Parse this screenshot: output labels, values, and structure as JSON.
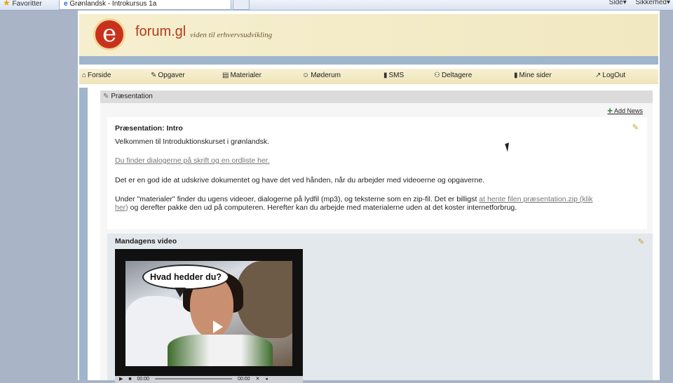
{
  "browser": {
    "favorites_label": "Favoritter",
    "tab_title": "Grønlandsk - Introkursus 1a",
    "tools": [
      "Side",
      "Sikkerhed"
    ]
  },
  "header": {
    "logo_letter": "e",
    "brand": "forum.gl",
    "slogan": "viden til erhvervsudvikling"
  },
  "nav": {
    "items": [
      {
        "label": "Forside",
        "icon": "home-icon"
      },
      {
        "label": "Opgaver",
        "icon": "tasks-icon"
      },
      {
        "label": "Materialer",
        "icon": "materials-icon"
      },
      {
        "label": "Møderum",
        "icon": "meeting-icon"
      },
      {
        "label": "SMS",
        "icon": "phone-icon"
      },
      {
        "label": "Deltagere",
        "icon": "people-icon"
      },
      {
        "label": "Mine sider",
        "icon": "user-icon"
      },
      {
        "label": "LogOut",
        "icon": "logout-icon"
      }
    ]
  },
  "panel": {
    "title": "Præsentation",
    "add_news": "Add News"
  },
  "content": {
    "title": "Præsentation: Intro",
    "welcome": "Velkommen til Introduktionskurset i grønlandsk.",
    "dialog_link": "Du finder dialogerne på skrift og en ordliste her.",
    "print_tip": "Det er en god ide at udskrive dokumentet og have det ved hånden, når du arbejder med videoerne og opgaverne.",
    "materials_text_1": "Under \"materialer\" finder du ugens videoer, dialogerne på lydfil (mp3), og teksterne som en zip-fil. Det er billigst ",
    "materials_link": "at hente filen præsentation.zip (klik her)",
    "materials_text_2": " og derefter pakke den ud på computeren. Herefter kan du arbejde med materialerne uden at det koster internetforbrug."
  },
  "video": {
    "title": "Mandagens video",
    "speech_bubble": "Hvad hedder du?",
    "time_elapsed": "00:00",
    "time_total": "00:00"
  }
}
